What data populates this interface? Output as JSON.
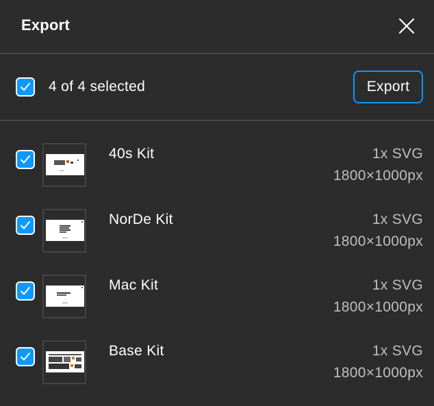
{
  "dialog": {
    "title": "Export"
  },
  "toolbar": {
    "selection_text": "4 of 4 selected",
    "export_label": "Export"
  },
  "items": [
    {
      "name": "40s Kit",
      "scale_format": "1x SVG",
      "dimensions": "1800×1000px"
    },
    {
      "name": "NorDe Kit",
      "scale_format": "1x SVG",
      "dimensions": "1800×1000px"
    },
    {
      "name": "Mac Kit",
      "scale_format": "1x SVG",
      "dimensions": "1800×1000px"
    },
    {
      "name": "Base Kit",
      "scale_format": "1x SVG",
      "dimensions": "1800×1000px"
    }
  ],
  "colors": {
    "background": "#2c2c2c",
    "accent": "#0d99ff",
    "divider": "#444444",
    "muted_text": "#bfbfbf"
  }
}
